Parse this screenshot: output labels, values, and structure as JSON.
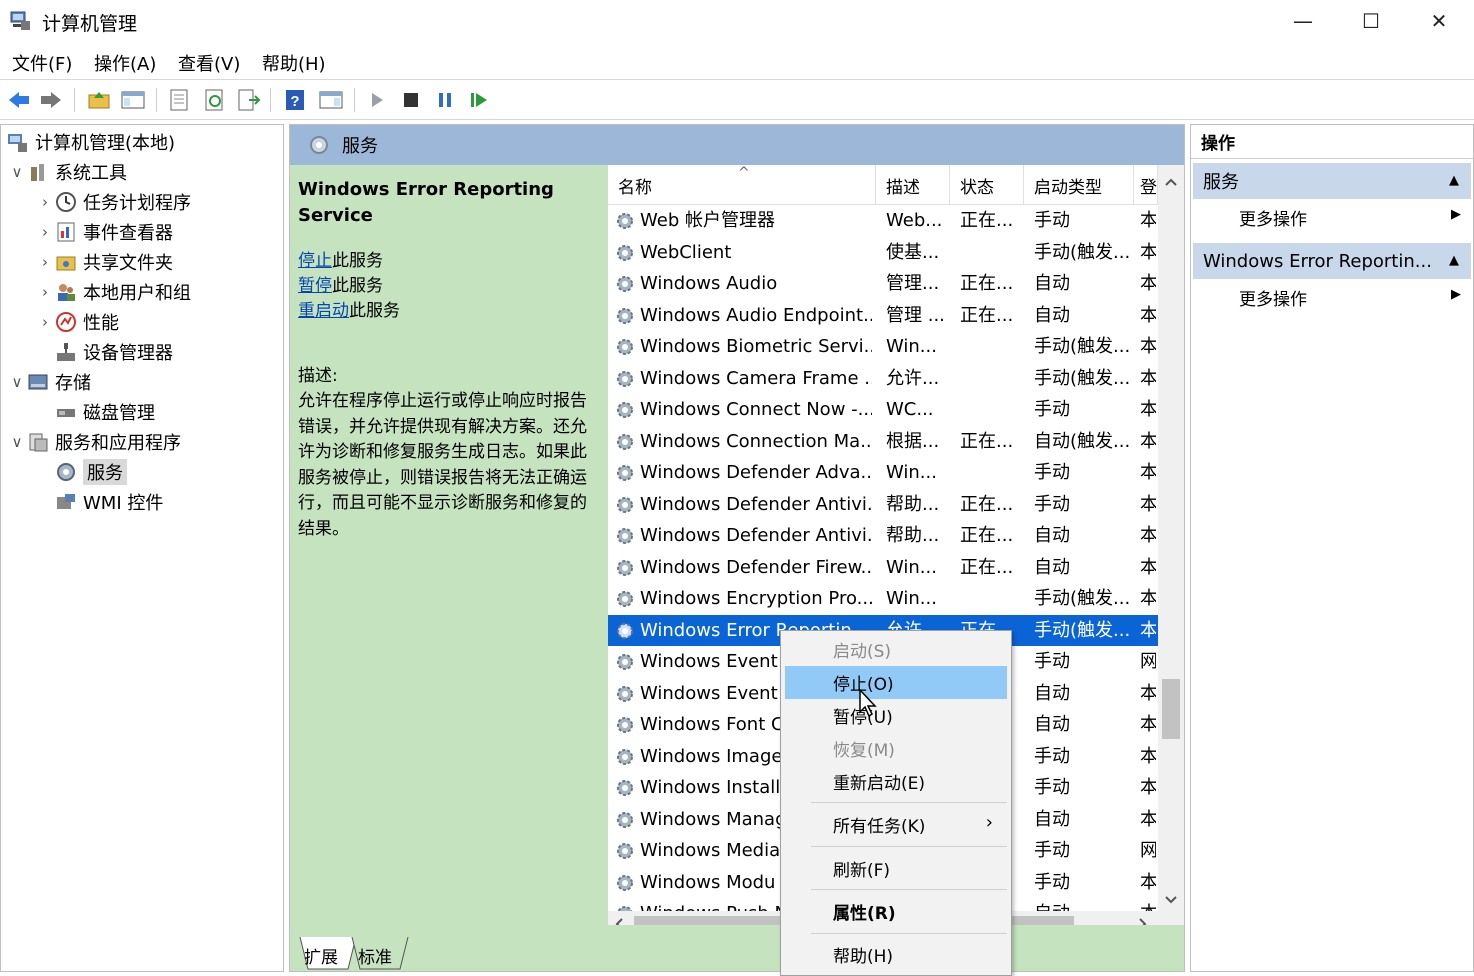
{
  "window": {
    "title": "计算机管理",
    "controls": {
      "minimize": "—",
      "maximize": "☐",
      "close": "✕"
    }
  },
  "menubar": [
    "文件(F)",
    "操作(A)",
    "查看(V)",
    "帮助(H)"
  ],
  "tree": {
    "root": "计算机管理(本地)",
    "nodes": [
      {
        "label": "系统工具",
        "level": 1,
        "expander": "∨"
      },
      {
        "label": "任务计划程序",
        "level": 2,
        "expander": "›"
      },
      {
        "label": "事件查看器",
        "level": 2,
        "expander": "›"
      },
      {
        "label": "共享文件夹",
        "level": 2,
        "expander": "›"
      },
      {
        "label": "本地用户和组",
        "level": 2,
        "expander": "›"
      },
      {
        "label": "性能",
        "level": 2,
        "expander": "›"
      },
      {
        "label": "设备管理器",
        "level": 2,
        "expander": ""
      },
      {
        "label": "存储",
        "level": 1,
        "expander": "∨"
      },
      {
        "label": "磁盘管理",
        "level": 2,
        "expander": ""
      },
      {
        "label": "服务和应用程序",
        "level": 1,
        "expander": "∨"
      },
      {
        "label": "服务",
        "level": 2,
        "expander": "",
        "selected": true
      },
      {
        "label": "WMI 控件",
        "level": 2,
        "expander": ""
      }
    ]
  },
  "services_panel": {
    "header": "服务",
    "selected_service_title": "Windows Error Reporting Service",
    "links": [
      {
        "link": "停止",
        "rest": "此服务"
      },
      {
        "link": "暂停",
        "rest": "此服务"
      },
      {
        "link": "重启动",
        "rest": "此服务"
      }
    ],
    "description_label": "描述:",
    "description": "允许在程序停止运行或停止响应时报告错误，并允许提供现有解决方案。还允许为诊断和修复服务生成日志。如果此服务被停止，则错误报告将无法正确运行，而且可能不显示诊断服务和修复的结果。",
    "columns": [
      "名称",
      "描述",
      "状态",
      "启动类型",
      "登"
    ],
    "sort_indicator": "^",
    "rows": [
      {
        "name": "Web 帐户管理器",
        "desc": "Web...",
        "status": "正在...",
        "startup": "手动",
        "logon": "本"
      },
      {
        "name": "WebClient",
        "desc": "使基...",
        "status": "",
        "startup": "手动(触发...",
        "logon": "本"
      },
      {
        "name": "Windows Audio",
        "desc": "管理...",
        "status": "正在...",
        "startup": "自动",
        "logon": "本"
      },
      {
        "name": "Windows Audio Endpoint...",
        "desc": "管理 ...",
        "status": "正在...",
        "startup": "自动",
        "logon": "本"
      },
      {
        "name": "Windows Biometric Servi...",
        "desc": "Win...",
        "status": "",
        "startup": "手动(触发...",
        "logon": "本"
      },
      {
        "name": "Windows Camera Frame ...",
        "desc": "允许...",
        "status": "",
        "startup": "手动(触发...",
        "logon": "本"
      },
      {
        "name": "Windows Connect Now -...",
        "desc": "WC...",
        "status": "",
        "startup": "手动",
        "logon": "本"
      },
      {
        "name": "Windows Connection Ma...",
        "desc": "根据...",
        "status": "正在...",
        "startup": "自动(触发...",
        "logon": "本"
      },
      {
        "name": "Windows Defender Adva...",
        "desc": "Win...",
        "status": "",
        "startup": "手动",
        "logon": "本"
      },
      {
        "name": "Windows Defender Antivi...",
        "desc": "帮助...",
        "status": "正在...",
        "startup": "手动",
        "logon": "本"
      },
      {
        "name": "Windows Defender Antivi...",
        "desc": "帮助...",
        "status": "正在...",
        "startup": "自动",
        "logon": "本"
      },
      {
        "name": "Windows Defender Firew...",
        "desc": "Win...",
        "status": "正在...",
        "startup": "自动",
        "logon": "本"
      },
      {
        "name": "Windows Encryption Pro...",
        "desc": "Win...",
        "status": "",
        "startup": "手动(触发...",
        "logon": "本"
      },
      {
        "name": "Windows Error Reportin...",
        "desc": "允许...",
        "status": "正在...",
        "startup": "手动(触发...",
        "logon": "本",
        "selected": true
      },
      {
        "name": "Windows Event",
        "desc": "",
        "status": "",
        "startup": "手动",
        "logon": "网"
      },
      {
        "name": "Windows Event",
        "desc": "",
        "status": "",
        "startup": "自动",
        "logon": "本"
      },
      {
        "name": "Windows Font C",
        "desc": "",
        "status": "",
        "startup": "自动",
        "logon": "本"
      },
      {
        "name": "Windows Image",
        "desc": "",
        "status": "",
        "startup": "手动",
        "logon": "本"
      },
      {
        "name": "Windows Install",
        "desc": "",
        "status": "",
        "startup": "手动",
        "logon": "本"
      },
      {
        "name": "Windows Manag",
        "desc": "",
        "status": "",
        "startup": "自动",
        "logon": "本"
      },
      {
        "name": "Windows Media",
        "desc": "",
        "status": "",
        "startup": "手动",
        "logon": "网"
      },
      {
        "name": "Windows Modu",
        "desc": "",
        "status": "",
        "startup": "手动",
        "logon": "本"
      },
      {
        "name": "Windows Push N",
        "desc": "",
        "status": "",
        "startup": "自动",
        "logon": "本"
      }
    ],
    "tabs": [
      "扩展",
      "标准"
    ]
  },
  "actions_panel": {
    "header": "操作",
    "sections": [
      {
        "title": "服务",
        "item": "更多操作"
      },
      {
        "title": "Windows Error Reportin...",
        "item": "更多操作"
      }
    ]
  },
  "context_menu": {
    "items": [
      {
        "label": "启动(S)",
        "state": "disabled"
      },
      {
        "label": "停止(O)",
        "state": "highlighted"
      },
      {
        "label": "暂停(U)",
        "state": "normal"
      },
      {
        "label": "恢复(M)",
        "state": "disabled"
      },
      {
        "label": "重新启动(E)",
        "state": "normal"
      },
      {
        "label": "所有任务(K)",
        "state": "normal",
        "submenu": "›"
      },
      {
        "label": "刷新(F)",
        "state": "normal"
      },
      {
        "label": "属性(R)",
        "state": "bold"
      },
      {
        "label": "帮助(H)",
        "state": "normal"
      }
    ]
  },
  "colors": {
    "selection": "#0a64d6",
    "menu_highlight": "#91c9f7",
    "panel_green": "#c5e3bf",
    "header_blue": "#9db7d8",
    "action_section": "#c9d7ea",
    "link": "#0645ad"
  }
}
